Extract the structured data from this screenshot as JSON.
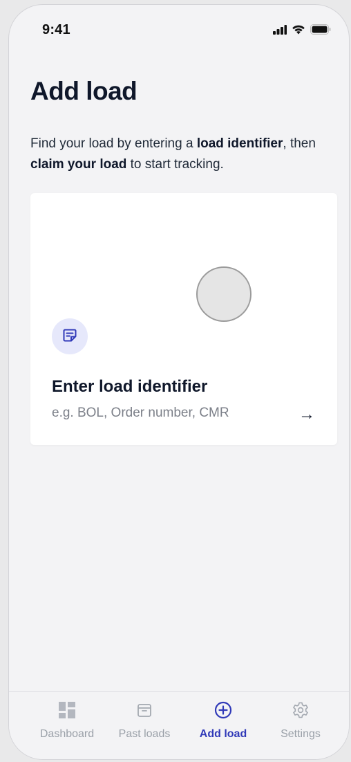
{
  "status_bar": {
    "time": "9:41",
    "icons": [
      "signal-icon",
      "wifi-icon",
      "battery-icon"
    ]
  },
  "page": {
    "title": "Add load",
    "intro": {
      "part1": "Find your load by entering a ",
      "bold1": "load identifier",
      "part2": ", then ",
      "bold2": "claim your load",
      "part3": " to start tracking."
    }
  },
  "card": {
    "icon": "document-icon",
    "title": "Enter load identifier",
    "subtitle": "e.g. BOL, Order number, CMR",
    "arrow": "→"
  },
  "tab_bar": {
    "items": [
      {
        "label": "Dashboard",
        "icon": "dashboard-icon",
        "active": false
      },
      {
        "label": "Past loads",
        "icon": "archive-box-icon",
        "active": false
      },
      {
        "label": "Add load",
        "icon": "plus-circle-icon",
        "active": true
      },
      {
        "label": "Settings",
        "icon": "gear-icon",
        "active": false
      }
    ]
  },
  "colors": {
    "accent": "#3039b8",
    "background": "#f3f3f5",
    "card": "#ffffff",
    "icon_bg": "#e6e8fb",
    "muted_text": "#7b7f88",
    "inactive_tab": "#9aa0a8"
  }
}
